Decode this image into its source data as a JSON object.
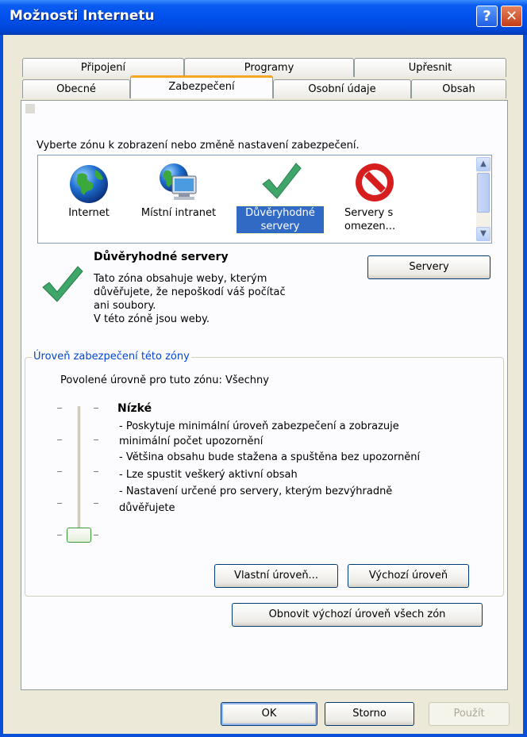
{
  "window": {
    "title": "Možnosti Internetu"
  },
  "titlebar_buttons": {
    "help": "?",
    "close": "✕"
  },
  "tabs": {
    "row_back": [
      "Připojení",
      "Programy",
      "Upřesnit"
    ],
    "row_front": [
      "Obecné",
      "Zabezpečení",
      "Osobní údaje",
      "Obsah"
    ],
    "active": "Zabezpečení"
  },
  "zones": {
    "instruction": "Vyberte zónu k zobrazení nebo změně nastavení zabezpečení.",
    "items": [
      {
        "label": "Internet",
        "icon": "globe-icon"
      },
      {
        "label": "Místní intranet",
        "icon": "intranet-icon"
      },
      {
        "label": "Důvěryhodné servery",
        "icon": "checkmark-icon",
        "selected": true
      },
      {
        "label": "Servery s omezen...",
        "icon": "restricted-icon"
      }
    ]
  },
  "zone_info": {
    "title": "Důvěryhodné servery",
    "description_lines": [
      "Tato zóna obsahuje weby, kterým",
      "důvěřujete, že nepoškodí váš počítač",
      "ani soubory.",
      "V této zóně jsou weby."
    ],
    "sites_button": "Servery"
  },
  "security_level": {
    "group_label": "Úroveň zabezpečení této zóny",
    "allowed_levels": "Povolené úrovně pro tuto zónu: Všechny",
    "level_name": "Nízké",
    "details": [
      "- Poskytuje minimální úroveň zabezpečení a zobrazuje",
      "minimální počet upozornění",
      "- Většina obsahu bude stažena a spuštěna bez upozornění",
      "- Lze spustit veškerý aktivní obsah",
      "- Nastavení určené pro servery, kterým bezvýhradně",
      "důvěřujete"
    ],
    "slider_position": 0,
    "custom_button": "Vlastní úroveň...",
    "default_button": "Výchozí úroveň"
  },
  "reset_all_button": "Obnovit výchozí úroveň všech zón",
  "footer": {
    "ok": "OK",
    "cancel": "Storno",
    "apply": "Použít"
  },
  "colors": {
    "title_bar": "#0054e3",
    "selected_zone": "#316ac5",
    "group_label": "#0046d5"
  }
}
